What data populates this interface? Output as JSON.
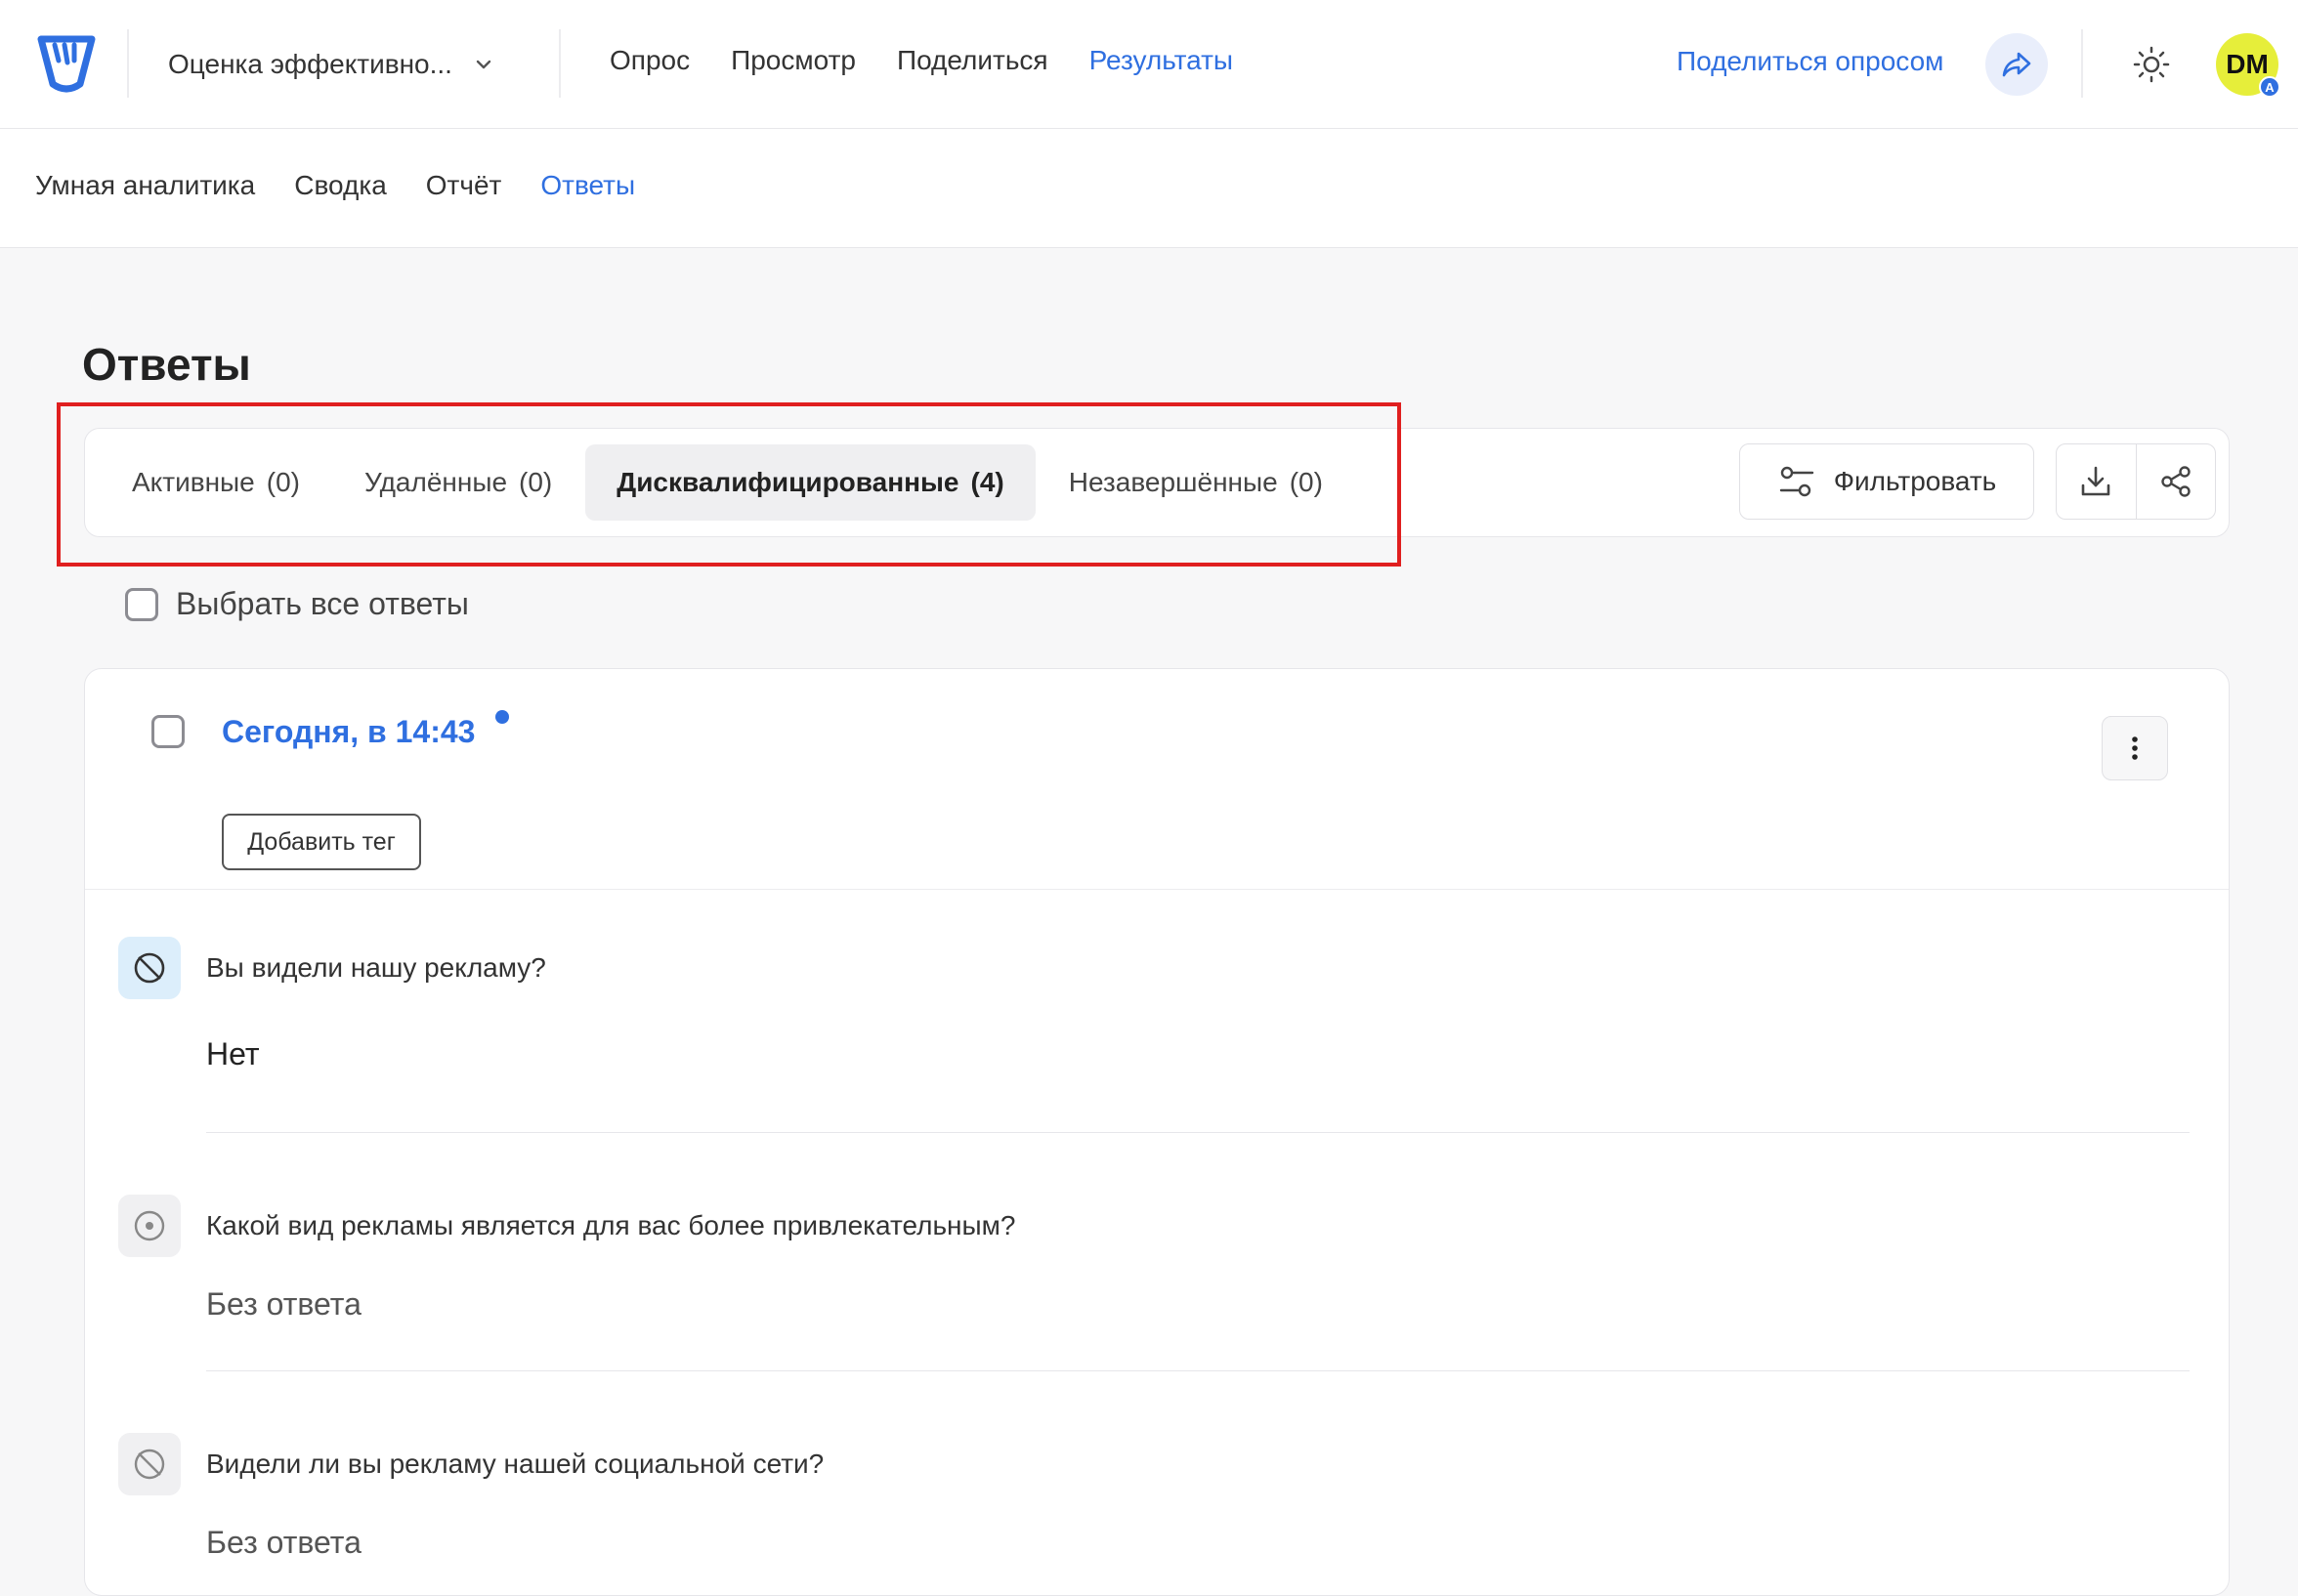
{
  "header": {
    "survey_title": "Оценка эффективно...",
    "nav": [
      "Опрос",
      "Просмотр",
      "Поделиться",
      "Результаты"
    ],
    "active_nav": "Результаты",
    "share_survey_label": "Поделиться опросом",
    "avatar_initials": "DM",
    "avatar_badge": "A"
  },
  "subnav": {
    "items": [
      "Умная аналитика",
      "Сводка",
      "Отчёт",
      "Ответы"
    ],
    "active": "Ответы"
  },
  "page": {
    "title": "Ответы"
  },
  "tabs": [
    {
      "label": "Активные",
      "count": "(0)"
    },
    {
      "label": "Удалённые",
      "count": "(0)"
    },
    {
      "label": "Дисквалифицированные",
      "count": "(4)"
    },
    {
      "label": "Незавершённые",
      "count": "(0)"
    }
  ],
  "active_tab": "Дисквалифицированные",
  "toolbar": {
    "filter_label": "Фильтровать"
  },
  "select_all_label": "Выбрать все ответы",
  "response": {
    "date": "Сегодня, в 14:43",
    "add_tag_label": "Добавить тег",
    "questions": [
      {
        "text": "Вы видели нашу рекламу?",
        "answer": "Нет"
      },
      {
        "text": "Какой вид рекламы является для вас более привлекательным?",
        "answer": "Без ответа"
      },
      {
        "text": "Видели ли вы рекламу нашей социальной сети?",
        "answer": "Без ответа"
      }
    ]
  },
  "colors": {
    "accent": "#2f6fe0",
    "highlight": "#e01f1f",
    "avatar_bg": "#e6ee3a"
  }
}
